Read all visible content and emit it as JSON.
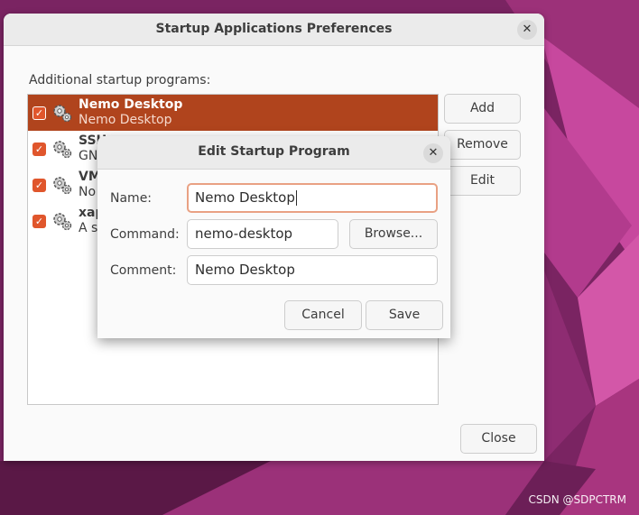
{
  "window": {
    "title": "Startup Applications Preferences",
    "section_label": "Additional startup programs:",
    "buttons": {
      "add": "Add",
      "remove": "Remove",
      "edit": "Edit",
      "close": "Close"
    },
    "programs": [
      {
        "name": "Nemo Desktop",
        "description": "Nemo Desktop",
        "checked": true,
        "selected": true
      },
      {
        "name": "SSH",
        "description": "GN",
        "checked": true,
        "selected": false
      },
      {
        "name": "VM",
        "description": "No",
        "checked": true,
        "selected": false
      },
      {
        "name": "xap",
        "description": "A s",
        "checked": true,
        "selected": false
      }
    ]
  },
  "dialog": {
    "title": "Edit Startup Program",
    "name_label": "Name:",
    "name_value": "Nemo Desktop",
    "command_label": "Command:",
    "command_value": "nemo-desktop",
    "browse_label": "Browse...",
    "comment_label": "Comment:",
    "comment_value": "Nemo Desktop",
    "cancel_label": "Cancel",
    "save_label": "Save"
  },
  "icons": {
    "close": "close-icon",
    "program": "gear-icon",
    "check": "checkmark-icon"
  },
  "colors": {
    "accent": "#e0562c",
    "selected_row": "#b0441d",
    "focus_border": "#e9a183"
  },
  "watermark": "CSDN @SDPCTRM"
}
